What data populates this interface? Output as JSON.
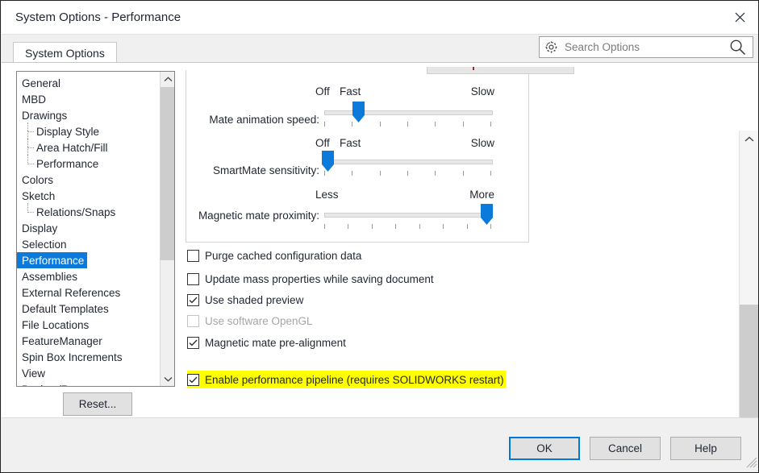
{
  "window": {
    "title": "System Options - Performance",
    "close_icon": "close-icon"
  },
  "tabs": [
    {
      "label": "System Options",
      "active": true
    }
  ],
  "search": {
    "placeholder": "Search Options",
    "value": "",
    "left_icon": "gear-icon",
    "right_icon": "search-icon"
  },
  "sidebar": {
    "selected": "Performance",
    "items": [
      {
        "label": "General",
        "level": 0
      },
      {
        "label": "MBD",
        "level": 0
      },
      {
        "label": "Drawings",
        "level": 0
      },
      {
        "label": "Display Style",
        "level": 1
      },
      {
        "label": "Area Hatch/Fill",
        "level": 1
      },
      {
        "label": "Performance",
        "level": 1
      },
      {
        "label": "Colors",
        "level": 0
      },
      {
        "label": "Sketch",
        "level": 0
      },
      {
        "label": "Relations/Snaps",
        "level": 1
      },
      {
        "label": "Display",
        "level": 0
      },
      {
        "label": "Selection",
        "level": 0
      },
      {
        "label": "Performance",
        "level": 0
      },
      {
        "label": "Assemblies",
        "level": 0
      },
      {
        "label": "External References",
        "level": 0
      },
      {
        "label": "Default Templates",
        "level": 0
      },
      {
        "label": "File Locations",
        "level": 0
      },
      {
        "label": "FeatureManager",
        "level": 0
      },
      {
        "label": "Spin Box Increments",
        "level": 0
      },
      {
        "label": "View",
        "level": 0
      },
      {
        "label": "Backup/Recover",
        "level": 0
      }
    ]
  },
  "reset": {
    "label": "Reset..."
  },
  "sliders": [
    {
      "label": "Mate animation speed:",
      "left_cap": "Off",
      "mid_cap": "Fast",
      "right_cap": "Slow",
      "value_pct": 20,
      "ticks": 7
    },
    {
      "label": "SmartMate sensitivity:",
      "left_cap": "Off",
      "mid_cap": "Fast",
      "right_cap": "Slow",
      "value_pct": 2,
      "ticks": 7
    },
    {
      "label": "Magnetic mate proximity:",
      "left_cap": "Less",
      "mid_cap": "",
      "right_cap": "More",
      "value_pct": 96,
      "ticks": 8
    }
  ],
  "checkboxes": [
    {
      "label": "Purge cached configuration data",
      "checked": false,
      "disabled": false,
      "highlight": false
    },
    {
      "label": "Update mass properties while saving document",
      "checked": false,
      "disabled": false,
      "highlight": false
    },
    {
      "label": "Use shaded preview",
      "checked": true,
      "disabled": false,
      "highlight": false
    },
    {
      "label": "Use software OpenGL",
      "checked": false,
      "disabled": true,
      "highlight": false
    },
    {
      "label": "Magnetic mate pre-alignment",
      "checked": true,
      "disabled": false,
      "highlight": false
    },
    {
      "label": "Enable performance pipeline (requires SOLIDWORKS restart)",
      "checked": true,
      "disabled": false,
      "highlight": true
    }
  ],
  "footer": {
    "ok": "OK",
    "cancel": "Cancel",
    "help": "Help"
  },
  "colors": {
    "accent": "#0b7ada",
    "focus": "#0078d7",
    "highlight": "#ffff00",
    "thumb": "#0b7ada"
  }
}
